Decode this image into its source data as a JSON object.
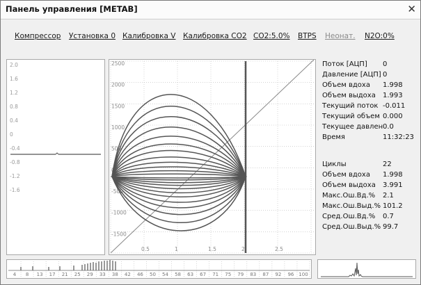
{
  "window": {
    "title": "Панель управления [METAB]",
    "close_glyph": "✕"
  },
  "menu": [
    {
      "label": "Компрессор",
      "enabled": true
    },
    {
      "label": "Установка 0",
      "enabled": true
    },
    {
      "label": "Калибровка V",
      "enabled": true
    },
    {
      "label": "Калибровка CO2",
      "enabled": true
    },
    {
      "label": "CO2:5.0%",
      "enabled": true
    },
    {
      "label": "BTPS",
      "enabled": true
    },
    {
      "label": "Неонат.",
      "enabled": false
    },
    {
      "label": "N2O:0%",
      "enabled": true
    }
  ],
  "left_chart": {
    "tick_labels": [
      "2.0",
      "1.6",
      "1.2",
      "0.8",
      "0.4",
      "0",
      "-0.4",
      "-0.8",
      "-1.2",
      "-1.6"
    ]
  },
  "loop_chart": {
    "y_ticks": [
      "2500",
      "2000",
      "1500",
      "1000",
      "500",
      "0",
      "-500",
      "-1000",
      "-1500"
    ],
    "x_ticks": [
      "0.5",
      "1",
      "1.5",
      "2",
      "2.5"
    ]
  },
  "info": {
    "top": [
      {
        "label": "Поток [АЦП]",
        "value": "0"
      },
      {
        "label": "Давление [АЦП]",
        "value": "0"
      },
      {
        "label": "Объем вдоха",
        "value": "1.998"
      },
      {
        "label": "Объем выдоха",
        "value": "1.993"
      },
      {
        "label": "Текущий поток",
        "value": "-0.011"
      },
      {
        "label": "Текущий объем",
        "value": "0.000"
      },
      {
        "label": "Текущее давлен",
        "value": "0.0"
      },
      {
        "label": "Время",
        "value": "11:32:23"
      }
    ],
    "bottom": [
      {
        "label": "Циклы",
        "value": "22"
      },
      {
        "label": "Объем вдоха",
        "value": "1.998"
      },
      {
        "label": "Объем выдоха",
        "value": "3.991"
      },
      {
        "label": "Макс.Ош.Вд.%",
        "value": "2.1"
      },
      {
        "label": "Макс.Ош.Выд.%",
        "value": "101.2"
      },
      {
        "label": "Сред.Ош.Вд.%",
        "value": "0.7"
      },
      {
        "label": "Сред.Ош.Выд.%",
        "value": "99.7"
      }
    ]
  },
  "histogram": {
    "bins": [
      "4",
      "8",
      "13",
      "17",
      "21",
      "25",
      "29",
      "33",
      "38",
      "42",
      "46",
      "50",
      "54",
      "58",
      "63",
      "67",
      "71",
      "75",
      "79",
      "83",
      "87",
      "92",
      "96",
      "100"
    ]
  },
  "colors": {
    "trace": "#555555",
    "grid": "#b8b8b8",
    "panel_bg": "#ffffff"
  }
}
